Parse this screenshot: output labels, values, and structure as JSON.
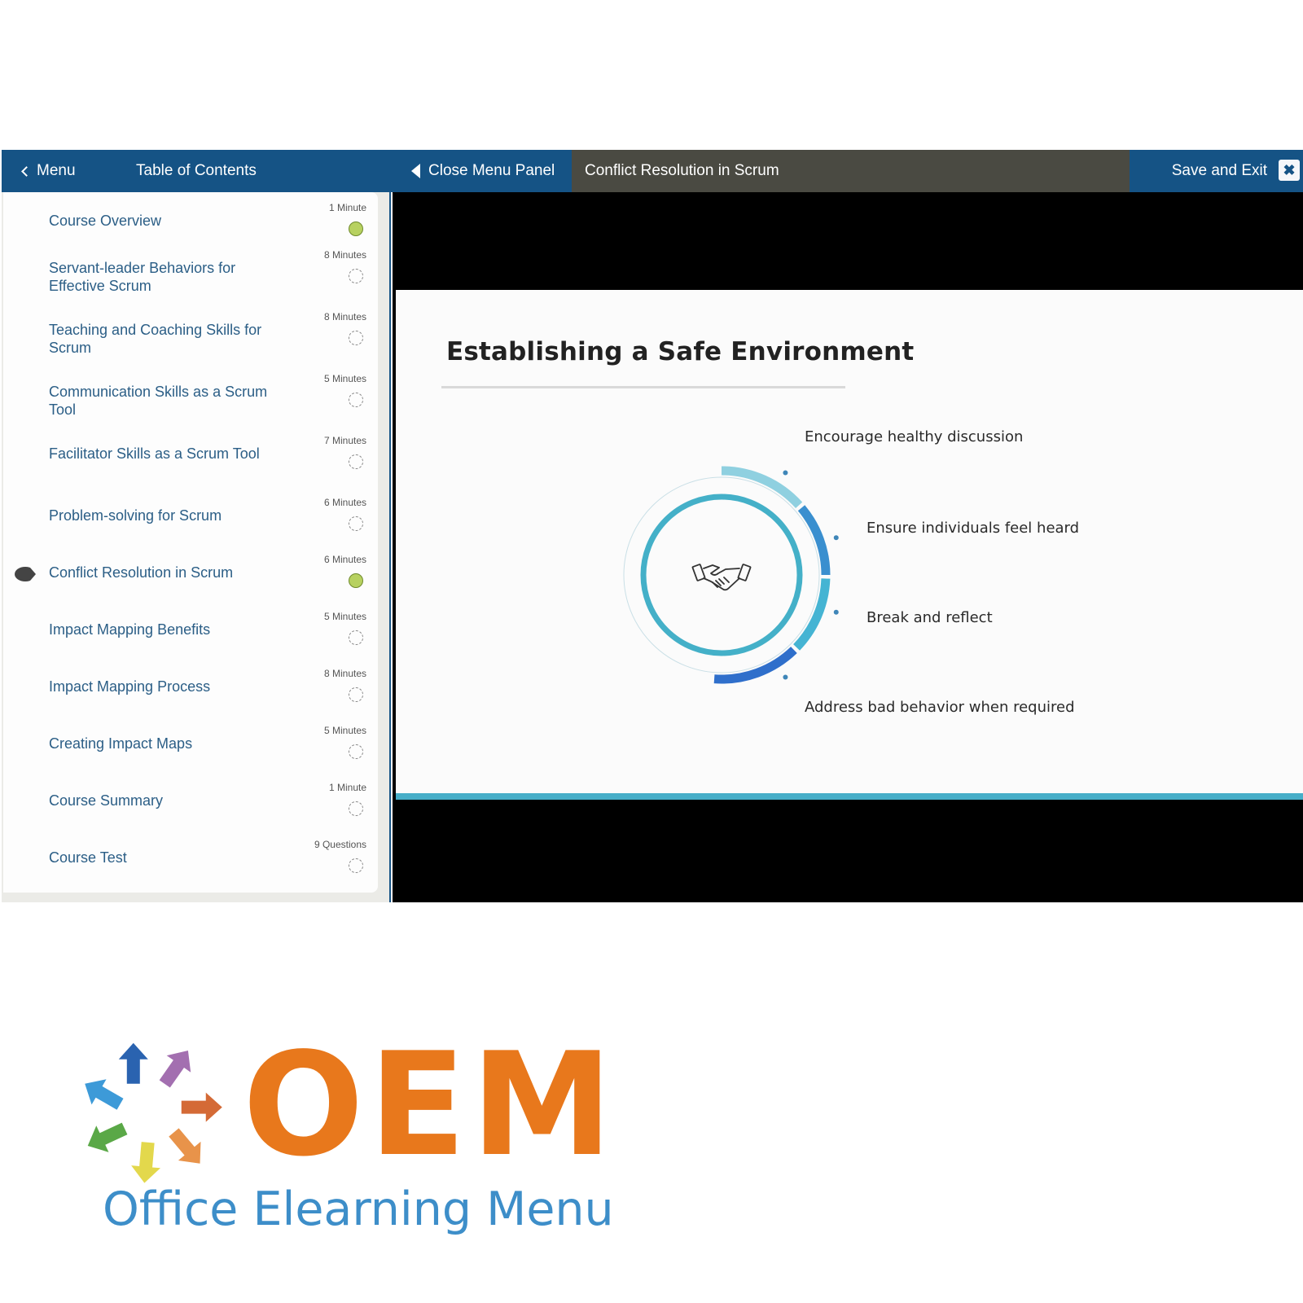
{
  "topbar": {
    "menu_label": "Menu",
    "toc_title": "Table of Contents",
    "close_panel_label": "Close Menu Panel",
    "course_title": "Conflict Resolution in Scrum",
    "save_exit_label": "Save and Exit",
    "close_icon_glyph": "✖"
  },
  "toc": {
    "items": [
      {
        "title": "Course Overview",
        "duration": "1 Minute",
        "status": "done",
        "current": false
      },
      {
        "title": "Servant-leader Behaviors for Effective Scrum",
        "duration": "8 Minutes",
        "status": "pending",
        "current": false
      },
      {
        "title": "Teaching and Coaching Skills for Scrum",
        "duration": "8 Minutes",
        "status": "pending",
        "current": false
      },
      {
        "title": "Communication Skills as a Scrum Tool",
        "duration": "5 Minutes",
        "status": "pending",
        "current": false
      },
      {
        "title": "Facilitator Skills as a Scrum Tool",
        "duration": "7 Minutes",
        "status": "pending",
        "current": false
      },
      {
        "title": "Problem-solving for Scrum",
        "duration": "6 Minutes",
        "status": "pending",
        "current": false
      },
      {
        "title": "Conflict Resolution in Scrum",
        "duration": "6 Minutes",
        "status": "done",
        "current": true
      },
      {
        "title": "Impact Mapping Benefits",
        "duration": "5 Minutes",
        "status": "pending",
        "current": false
      },
      {
        "title": "Impact Mapping Process",
        "duration": "8 Minutes",
        "status": "pending",
        "current": false
      },
      {
        "title": "Creating Impact Maps",
        "duration": "5 Minutes",
        "status": "pending",
        "current": false
      },
      {
        "title": "Course Summary",
        "duration": "1 Minute",
        "status": "pending",
        "current": false
      },
      {
        "title": "Course Test",
        "duration": "9 Questions",
        "status": "pending",
        "current": false
      }
    ]
  },
  "slide": {
    "title": "Establishing a Safe Environment",
    "center_icon": "handshake-icon",
    "points": [
      "Encourage healthy discussion",
      "Ensure individuals feel heard",
      "Break and reflect",
      "Address bad behavior when required"
    ],
    "ring_colors": [
      "#8fd0e0",
      "#3a8fcf",
      "#45b4d3",
      "#2f6fcb"
    ],
    "inner_ring_color": "#44b0c8"
  },
  "logo": {
    "mark": "OEM",
    "tagline": "Office Elearning Menu",
    "arrow_colors": [
      "#2a63b0",
      "#a36fb0",
      "#d46a36",
      "#e8934a",
      "#e3d84c",
      "#5aa847",
      "#3d9ad8"
    ]
  }
}
